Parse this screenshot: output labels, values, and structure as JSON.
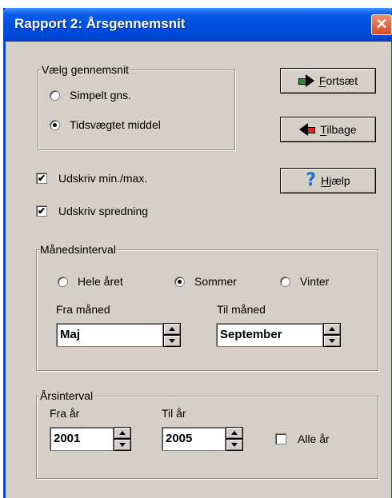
{
  "window": {
    "title": "Rapport 2: Årsgennemsnit",
    "close_glyph": "✕"
  },
  "average_group": {
    "legend": "Vælg gennemsnit",
    "options": [
      {
        "label": "Simpelt gns.",
        "checked": false
      },
      {
        "label": "Tidsvægtet middel",
        "checked": true
      }
    ]
  },
  "checkboxes": {
    "print_minmax": {
      "label": "Udskriv min./max.",
      "checked": true
    },
    "print_spread": {
      "label": "Udskriv spredning",
      "checked": true
    }
  },
  "buttons": {
    "continue": {
      "mnemonic": "F",
      "rest": "ortsæt",
      "icon": "right-arrow-icon",
      "color": "#2e8b2e"
    },
    "back": {
      "mnemonic": "T",
      "rest": "ilbage",
      "icon": "left-arrow-icon",
      "color": "#e0201c"
    },
    "help": {
      "mnemonic": "H",
      "rest": "jælp",
      "icon": "question-mark-icon",
      "glyph": "?"
    }
  },
  "month_group": {
    "legend": "Månedsinterval",
    "options": [
      {
        "label": "Hele året",
        "checked": false
      },
      {
        "label": "Sommer",
        "checked": true
      },
      {
        "label": "Vinter",
        "checked": false
      }
    ],
    "from_label": "Fra måned",
    "from_value": "Maj",
    "to_label": "Til måned",
    "to_value": "September"
  },
  "year_group": {
    "legend": "Årsinterval",
    "from_label": "Fra år",
    "from_value": "2001",
    "to_label": "Til år",
    "to_value": "2005",
    "all_years": {
      "label": "Alle år",
      "checked": false
    }
  }
}
